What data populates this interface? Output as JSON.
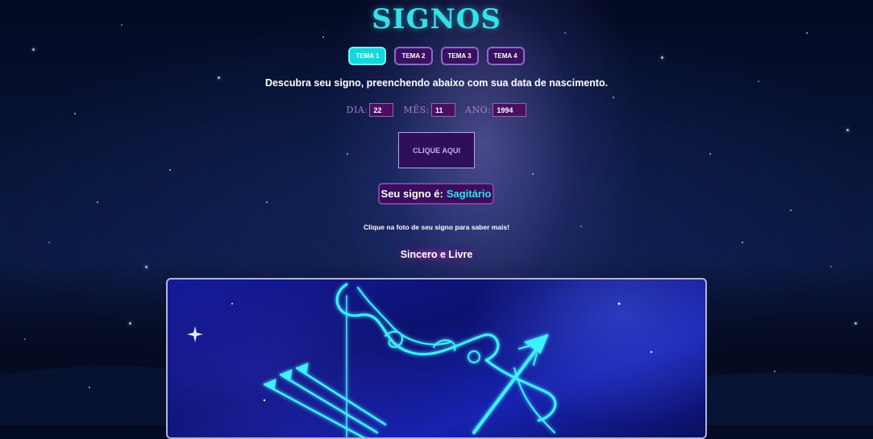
{
  "page": {
    "title": "SIGNOS",
    "instructions": "Descubra seu signo, preenchendo abaixo com sua data de nascimento.",
    "hint": "Clique na foto de seu signo para saber mais!"
  },
  "tabs": [
    {
      "label": "TEMA 1",
      "active": true
    },
    {
      "label": "TEMA 2",
      "active": false
    },
    {
      "label": "TEMA 3",
      "active": false
    },
    {
      "label": "TEMA 4",
      "active": false
    }
  ],
  "form": {
    "day_label": "DIA:",
    "day_value": "22",
    "month_label": "MÊS:",
    "month_value": "11",
    "year_label": "ANO:",
    "year_value": "1994",
    "button_label": "CLIQUE AQUI"
  },
  "result": {
    "prefix": "Seu signo é:",
    "sign": "Sagitário",
    "trait": "Sincero e Livre"
  },
  "image": {
    "subject": "sagittarius-zodiac-illustration"
  },
  "colors": {
    "accent": "#36e0e8",
    "purple": "#3a0e5a"
  }
}
